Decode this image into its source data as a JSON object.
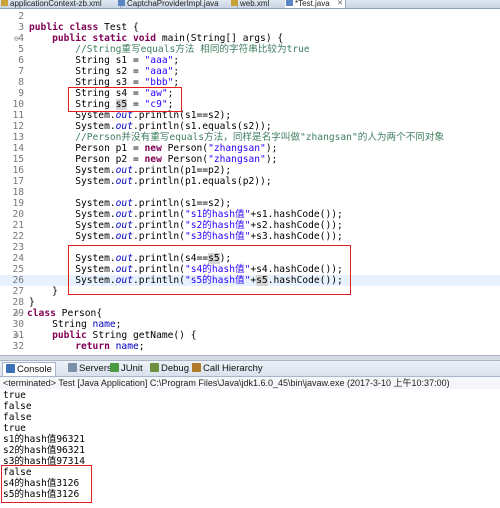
{
  "editor_tabs": [
    {
      "label": "applicationContext-zb.xml",
      "active": false
    },
    {
      "label": "CaptchaProviderImpl.java",
      "active": false
    },
    {
      "label": "web.xml",
      "active": false
    },
    {
      "label": "*Test.java",
      "active": true
    }
  ],
  "code": {
    "line_numbers": [
      "2",
      "3",
      "4",
      "5",
      "6",
      "7",
      "8",
      "9",
      "10",
      "11",
      "12",
      "13",
      "14",
      "15",
      "16",
      "17",
      "18",
      "19",
      "20",
      "21",
      "22",
      "23",
      "24",
      "25",
      "26",
      "27",
      "28",
      "29",
      "30",
      "31",
      "32"
    ],
    "l2": "",
    "l3": "public class Test {",
    "l4": "    public static void main(String[] args) {",
    "l5_comment": "        //String重写equals方法 相同的字符串比较为true",
    "l6_a": "        String s1 = ",
    "l6_s": "\"aaa\"",
    "l7_a": "        String s2 = ",
    "l7_s": "\"aaa\"",
    "l8_a": "        String s3 = ",
    "l8_s": "\"bbb\"",
    "l9_a": "        String s4 = ",
    "l9_s": "\"aw\"",
    "l10_a": "        String ",
    "l10_v": "s5",
    "l10_b": " = ",
    "l10_s": "\"c9\"",
    "l11_a": "        System.",
    "l11_f": "out",
    "l11_b": ".println(s1==s2);",
    "l12_a": "        System.",
    "l12_f": "out",
    "l12_b": ".println(s1.equals(s2));",
    "l13_comment": "        //Person并没有重写equals方法，同样是名字叫做\"zhangsan\"的人为两个不同对象",
    "l14_a": "        Person p1 = ",
    "l14_kw": "new",
    "l14_b": " Person(",
    "l14_s": "\"zhangsan\"",
    "l14_c": ");",
    "l15_a": "        Person p2 = ",
    "l15_kw": "new",
    "l15_b": " Person(",
    "l15_s": "\"zhangsan\"",
    "l15_c": ");",
    "l16_a": "        System.",
    "l16_f": "out",
    "l16_b": ".println(p1==p2);",
    "l17_a": "        System.",
    "l17_f": "out",
    "l17_b": ".println(p1.equals(p2));",
    "l19_a": "        System.",
    "l19_f": "out",
    "l19_b": ".println(s1==s2);",
    "l20_a": "        System.",
    "l20_f": "out",
    "l20_b": ".println(",
    "l20_s": "\"s1的hash值\"",
    "l20_c": "+s1.hashCode());",
    "l21_a": "        System.",
    "l21_f": "out",
    "l21_b": ".println(",
    "l21_s": "\"s2的hash值\"",
    "l21_c": "+s2.hashCode());",
    "l22_a": "        System.",
    "l22_f": "out",
    "l22_b": ".println(",
    "l22_s": "\"s3的hash值\"",
    "l22_c": "+s3.hashCode());",
    "l24_a": "        System.",
    "l24_f": "out",
    "l24_b": ".println(s4==",
    "l24_v": "s5",
    "l24_c": ");",
    "l25_a": "        System.",
    "l25_f": "out",
    "l25_b": ".println(",
    "l25_s": "\"s4的hash值\"",
    "l25_c": "+s4.hashCode());",
    "l26_a": "        System.",
    "l26_f": "out",
    "l26_b": ".println(",
    "l26_s": "\"s5的hash值\"",
    "l26_c": "+",
    "l26_v": "s5",
    "l26_d": ".hashCode());",
    "l27": "    }",
    "l28": "}",
    "l29_kw": "class",
    "l29_b": " Person{",
    "l30_a": "    String ",
    "l30_f": "name",
    "l30_b": ";",
    "l31_kw": "public",
    "l31_b": " String getName() {",
    "l32_kw": "return",
    "l32_f": "name",
    "l32_b": ";"
  },
  "console_tabs": [
    {
      "label": "Console",
      "icon": "console-icon",
      "color": "#3b6fb6",
      "active": true
    },
    {
      "label": "Servers",
      "icon": "servers-icon",
      "color": "#7a8fa8",
      "active": false
    },
    {
      "label": "JUnit",
      "icon": "junit-icon",
      "color": "#4c9a3f",
      "active": false
    },
    {
      "label": "Debug",
      "icon": "debug-icon",
      "color": "#6b8f3a",
      "active": false
    },
    {
      "label": "Call Hierarchy",
      "icon": "call-hierarchy-icon",
      "color": "#b07a2a",
      "active": false
    }
  ],
  "console": {
    "terminated": "<terminated> Test [Java Application] C:\\Program Files\\Java\\jdk1.6.0_45\\bin\\javaw.exe (2017-3-10 上午10:37:00)",
    "lines": [
      "true",
      "false",
      "false",
      "true",
      "s1的hash值96321",
      "s2的hash值96321",
      "s3的hash值97314",
      "false",
      "s4的hash值3126",
      "s5的hash值3126"
    ]
  },
  "colors": {
    "highlight_box": "#e0201c",
    "keyword": "#7f0055",
    "string": "#2a00ff",
    "comment": "#3f7f5f",
    "field": "#0000c0"
  }
}
